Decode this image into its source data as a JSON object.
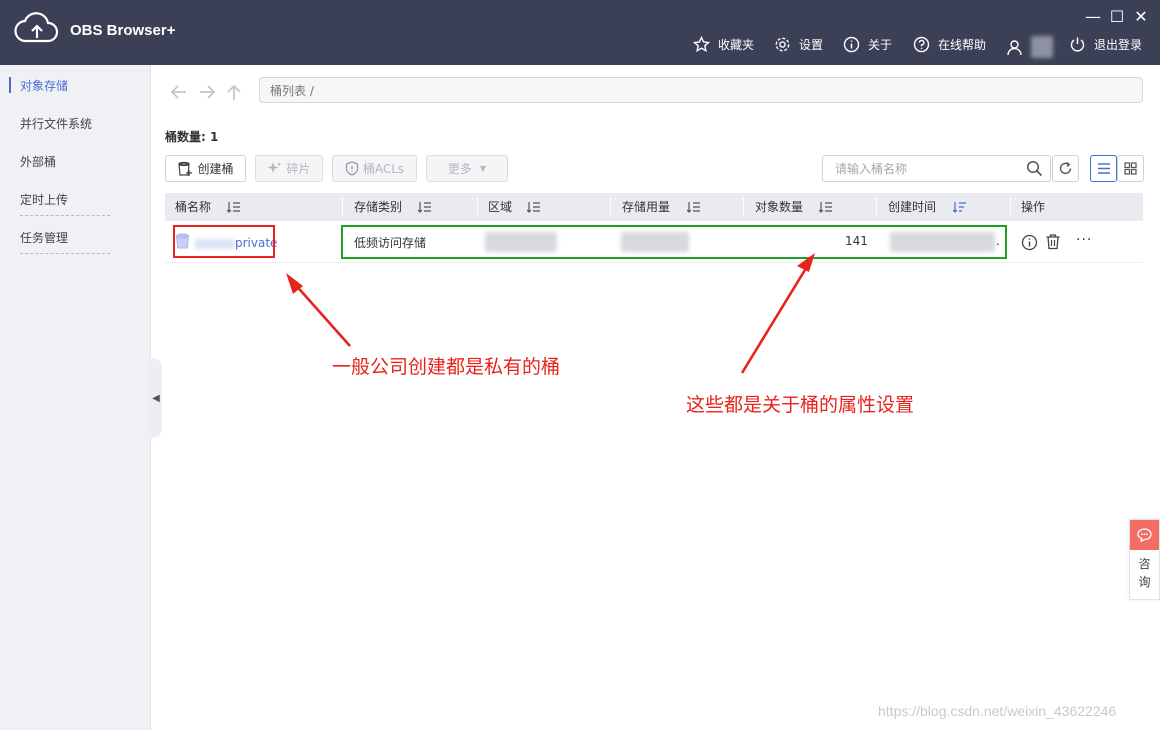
{
  "app": {
    "title": "OBS Browser+"
  },
  "topnav": {
    "favorites": "收藏夹",
    "settings": "设置",
    "about": "关于",
    "help": "在线帮助",
    "logout": "退出登录"
  },
  "window_controls": {
    "minimize": "—",
    "maximize": "☐",
    "close": "✕"
  },
  "sidebar": {
    "items": [
      {
        "label": "对象存储",
        "active": true
      },
      {
        "label": "并行文件系统",
        "active": false
      },
      {
        "label": "外部桶",
        "active": false
      },
      {
        "label": "定时上传",
        "active": false
      },
      {
        "label": "任务管理",
        "active": false
      }
    ]
  },
  "breadcrumb": {
    "text": "桶列表  /"
  },
  "bucket_count": {
    "label": "桶数量:  1"
  },
  "toolbar": {
    "create_bucket": "创建桶",
    "fragments": "碎片",
    "bucket_acls": "桶ACLs",
    "more": "更多",
    "search_placeholder": "请输入桶名称"
  },
  "table": {
    "columns": [
      "桶名称",
      "存储类别",
      "区域",
      "存储用量",
      "对象数量",
      "创建时间",
      "操作"
    ],
    "rows": [
      {
        "name_suffix": "private",
        "storage_class": "低频访问存储",
        "object_count": "141",
        "more_dots": "···",
        "trailing_dot": "."
      }
    ]
  },
  "annotations": {
    "private_bucket": "一般公司创建都是私有的桶",
    "bucket_properties": "这些都是关于桶的属性设置"
  },
  "consult": {
    "label": "咨\n询",
    "line1": "咨",
    "line2": "询"
  },
  "watermark": "https://blog.csdn.net/weixin_43622246",
  "colors": {
    "topbar": "#3b4057",
    "accent": "#4a6bd6",
    "annotation_red": "#e8231d",
    "annotation_green": "#1ea11e",
    "consult": "#f26d63"
  }
}
